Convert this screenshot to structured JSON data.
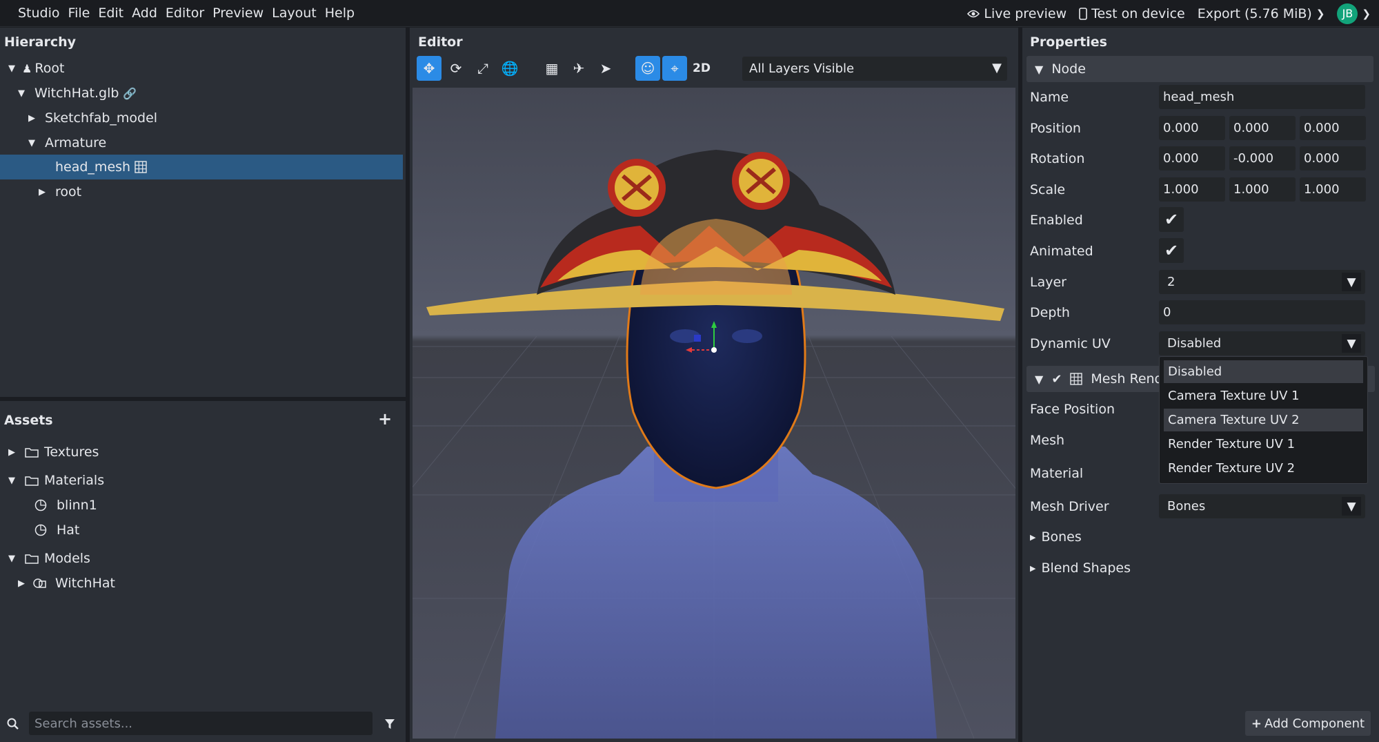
{
  "menubar": {
    "items": [
      "Studio",
      "File",
      "Edit",
      "Add",
      "Editor",
      "Preview",
      "Layout",
      "Help"
    ],
    "live_preview": "Live preview",
    "test_on_device": "Test on device",
    "export": "Export (5.76 MiB)",
    "avatar_initials": "JB"
  },
  "hierarchy": {
    "title": "Hierarchy",
    "nodes": [
      {
        "label": "Root"
      },
      {
        "label": "WitchHat.glb"
      },
      {
        "label": "Sketchfab_model"
      },
      {
        "label": "Armature"
      },
      {
        "label": "head_mesh"
      },
      {
        "label": "root"
      }
    ]
  },
  "assets": {
    "title": "Assets",
    "items": [
      {
        "label": "Textures"
      },
      {
        "label": "Materials"
      },
      {
        "label": "blinn1"
      },
      {
        "label": "Hat"
      },
      {
        "label": "Models"
      },
      {
        "label": "WitchHat"
      }
    ],
    "search_placeholder": "Search assets..."
  },
  "editor": {
    "title": "Editor",
    "mode_2d": "2D",
    "layers": "All Layers Visible"
  },
  "properties": {
    "title": "Properties",
    "node_section": "Node",
    "labels": {
      "name": "Name",
      "position": "Position",
      "rotation": "Rotation",
      "scale": "Scale",
      "enabled": "Enabled",
      "animated": "Animated",
      "layer": "Layer",
      "depth": "Depth",
      "dynamic_uv": "Dynamic UV",
      "face_position": "Face Position",
      "mesh": "Mesh",
      "material": "Material",
      "mesh_driver": "Mesh Driver",
      "bones": "Bones",
      "blend_shapes": "Blend Shapes"
    },
    "name": "head_mesh",
    "position": [
      "0.000",
      "0.000",
      "0.000"
    ],
    "rotation": [
      "0.000",
      "-0.000",
      "0.000"
    ],
    "scale": [
      "1.000",
      "1.000",
      "1.000"
    ],
    "layer": "2",
    "depth": "0",
    "dynamic_uv": "Disabled",
    "mesh_render_section": "Mesh Rende",
    "mesh_driver": "Bones",
    "dropdown_options": [
      "Disabled",
      "Camera Texture UV 1",
      "Camera Texture UV 2",
      "Render Texture UV 1",
      "Render Texture UV 2"
    ],
    "add_component": "Add Component"
  }
}
